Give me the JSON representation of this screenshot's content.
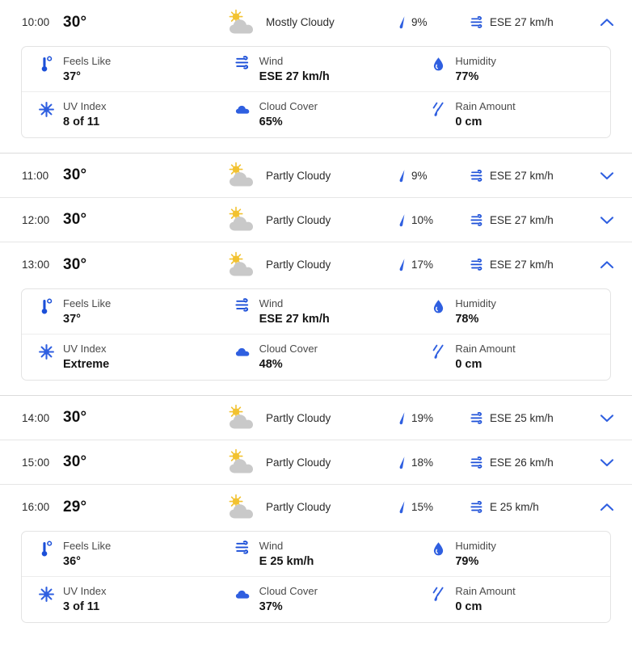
{
  "colors": {
    "accent_blue": "#2f5fe0",
    "icon_blue": "#1b4fd8",
    "sun_yellow": "#f2c230",
    "cloud_gray": "#c9c9c9",
    "text_primary": "#1a1a1a",
    "text_secondary": "#4a4a4a",
    "divider": "#e6e6e6",
    "card_border": "#e3e3e3"
  },
  "detail_labels": {
    "feels_like": "Feels Like",
    "wind": "Wind",
    "humidity": "Humidity",
    "uv_index": "UV Index",
    "cloud_cover": "Cloud Cover",
    "rain_amount": "Rain Amount"
  },
  "icon_names": {
    "condition_mostly_cloudy": "sun-behind-cloud-icon",
    "condition_partly_cloudy": "sun-behind-cloud-icon",
    "precip": "raindrop-streak-icon",
    "wind": "wind-lines-icon",
    "chevron_up": "chevron-up-icon",
    "chevron_down": "chevron-down-icon",
    "feels_like": "thermometer-degree-icon",
    "wind_detail": "wind-lines-icon",
    "humidity": "water-droplet-icon",
    "uv_index": "sun-burst-icon",
    "cloud_cover": "cloud-filled-icon",
    "rain_amount": "rain-streaks-icon"
  },
  "hours": [
    {
      "time": "10:00",
      "temp": "30°",
      "condition": "Mostly Cloudy",
      "precip": "9%",
      "wind": "ESE 27 km/h",
      "expanded": true,
      "chevron": "up",
      "details": {
        "feels_like": "37°",
        "wind": "ESE 27 km/h",
        "humidity": "77%",
        "uv_index": "8 of 11",
        "cloud_cover": "65%",
        "rain_amount": "0 cm"
      }
    },
    {
      "time": "11:00",
      "temp": "30°",
      "condition": "Partly Cloudy",
      "precip": "9%",
      "wind": "ESE 27 km/h",
      "expanded": false,
      "chevron": "down",
      "details": null
    },
    {
      "time": "12:00",
      "temp": "30°",
      "condition": "Partly Cloudy",
      "precip": "10%",
      "wind": "ESE 27 km/h",
      "expanded": false,
      "chevron": "down",
      "details": null
    },
    {
      "time": "13:00",
      "temp": "30°",
      "condition": "Partly Cloudy",
      "precip": "17%",
      "wind": "ESE 27 km/h",
      "expanded": true,
      "chevron": "up",
      "details": {
        "feels_like": "37°",
        "wind": "ESE 27 km/h",
        "humidity": "78%",
        "uv_index": "Extreme",
        "cloud_cover": "48%",
        "rain_amount": "0 cm"
      }
    },
    {
      "time": "14:00",
      "temp": "30°",
      "condition": "Partly Cloudy",
      "precip": "19%",
      "wind": "ESE 25 km/h",
      "expanded": false,
      "chevron": "down",
      "details": null
    },
    {
      "time": "15:00",
      "temp": "30°",
      "condition": "Partly Cloudy",
      "precip": "18%",
      "wind": "ESE 26 km/h",
      "expanded": false,
      "chevron": "down",
      "details": null
    },
    {
      "time": "16:00",
      "temp": "29°",
      "condition": "Partly Cloudy",
      "precip": "15%",
      "wind": "E 25 km/h",
      "expanded": true,
      "chevron": "up",
      "details": {
        "feels_like": "36°",
        "wind": "E 25 km/h",
        "humidity": "79%",
        "uv_index": "3 of 11",
        "cloud_cover": "37%",
        "rain_amount": "0 cm"
      }
    }
  ]
}
